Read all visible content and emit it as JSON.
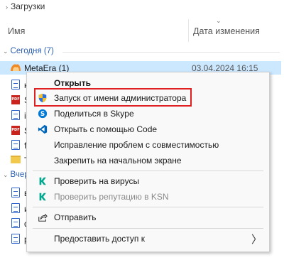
{
  "breadcrumb": {
    "label": "Загрузки"
  },
  "columns": {
    "name": "Имя",
    "date": "Дата изменения"
  },
  "groups": {
    "today": "Сегодня (7)",
    "yesterday": "Вчер"
  },
  "files": {
    "selected": {
      "name": "MetaEra (1)",
      "date": "03.04.2024 16:15"
    },
    "today_partial": [
      "к",
      "S",
      "ir",
      "S",
      "f",
      "T"
    ],
    "yesterday_partial": [
      "в",
      "и",
      "ф",
      "р"
    ]
  },
  "context_menu": {
    "items": [
      {
        "label": "Открыть",
        "icon": "none"
      },
      {
        "label": "Запуск от имени администратора",
        "icon": "uac-shield-icon"
      },
      {
        "label": "Поделиться в Skype",
        "icon": "skype-icon"
      },
      {
        "label": "Открыть с помощью Code",
        "icon": "vscode-icon"
      },
      {
        "label": "Исправление проблем с совместимостью",
        "icon": "none"
      },
      {
        "label": "Закрепить на начальном экране",
        "icon": "none"
      },
      {
        "label": "Проверить на вирусы",
        "icon": "kaspersky-icon"
      },
      {
        "label": "Проверить репутацию в KSN",
        "icon": "kaspersky-icon"
      },
      {
        "label": "Отправить",
        "icon": "share-icon"
      },
      {
        "label": "Предоставить доступ к",
        "icon": "none"
      }
    ],
    "submenu_arrow": "〉"
  },
  "colors": {
    "selection": "#cce8ff",
    "highlight": "#e02020",
    "kaspersky": "#00a88e",
    "skype": "#0078d4",
    "vscode": "#0066b8"
  }
}
